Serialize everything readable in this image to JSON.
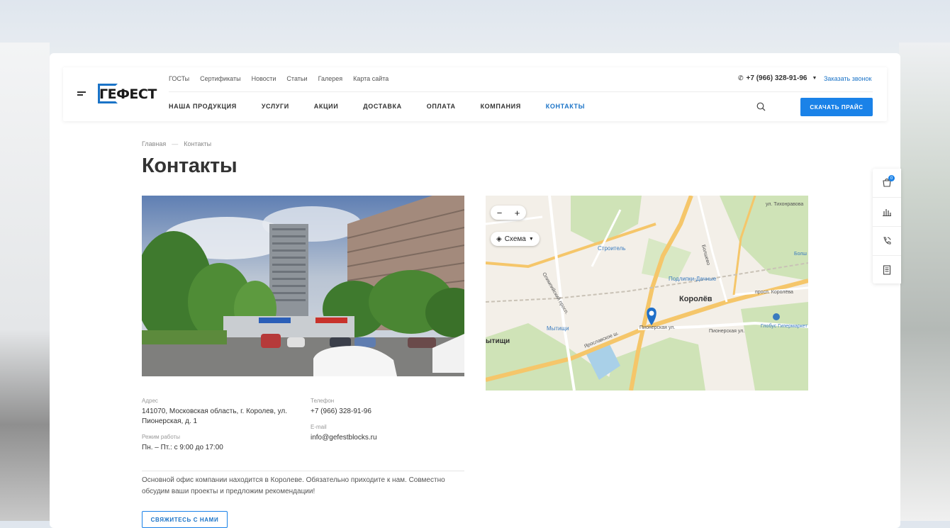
{
  "logo": {
    "text": "ГЕФЕСТ"
  },
  "header": {
    "top_links": [
      "ГОСТы",
      "Сертификаты",
      "Новости",
      "Статьи",
      "Галерея",
      "Карта сайта"
    ],
    "main_nav": [
      "НАША ПРОДУКЦИЯ",
      "УСЛУГИ",
      "АКЦИИ",
      "ДОСТАВКА",
      "ОПЛАТА",
      "КОМПАНИЯ",
      "КОНТАКТЫ"
    ],
    "active_nav": "КОНТАКТЫ",
    "phone": "+7 (966) 328-91-96",
    "callback": "Заказать звонок",
    "price_button": "СКАЧАТЬ ПРАЙС"
  },
  "breadcrumb": {
    "home": "Главная",
    "sep": "—",
    "current": "Контакты"
  },
  "page_title": "Контакты",
  "map": {
    "layer_label": "Схема",
    "labels": {
      "korolev": "Королёв",
      "stroitel": "Строитель",
      "podlipki": "Подлипки-Дачные",
      "mytishchi": "Мытищи",
      "mytishchi_part": "ытищи",
      "pionerskaya": "Пионерская ул.",
      "pionerskaya2": "Пионерская ул.",
      "yaroslavskoe": "Ярославское ш.",
      "olimpiyskiy": "Олимпийский просп.",
      "tikhonravova": "ул. Тихонравова",
      "korolyova": "просп. Королёва",
      "globus": "Глобус\nГипермаркет",
      "bolshevo": "Болшево",
      "bolsh": "Болш"
    }
  },
  "contacts": {
    "address_label": "Адрес",
    "address": "141070, Московская область, г. Королев, ул. Пионерская, д. 1",
    "hours_label": "Режим работы",
    "hours": "Пн. – Пт.: с 9:00 до 17:00",
    "phone_label": "Телефон",
    "phone": "+7 (966) 328-91-96",
    "email_label": "E-mail",
    "email": "info@gefestblocks.ru"
  },
  "description": "Основной офис компании находится в Королеве. Обязательно приходите к нам. Совместно обсудим ваши проекты и предложим рекомендации!",
  "contact_button": "СВЯЖИТЕСЬ С НАМИ",
  "side_panel": {
    "cart_count": "0"
  },
  "colors": {
    "accent": "#1a82e8",
    "link": "#1a73c7"
  }
}
